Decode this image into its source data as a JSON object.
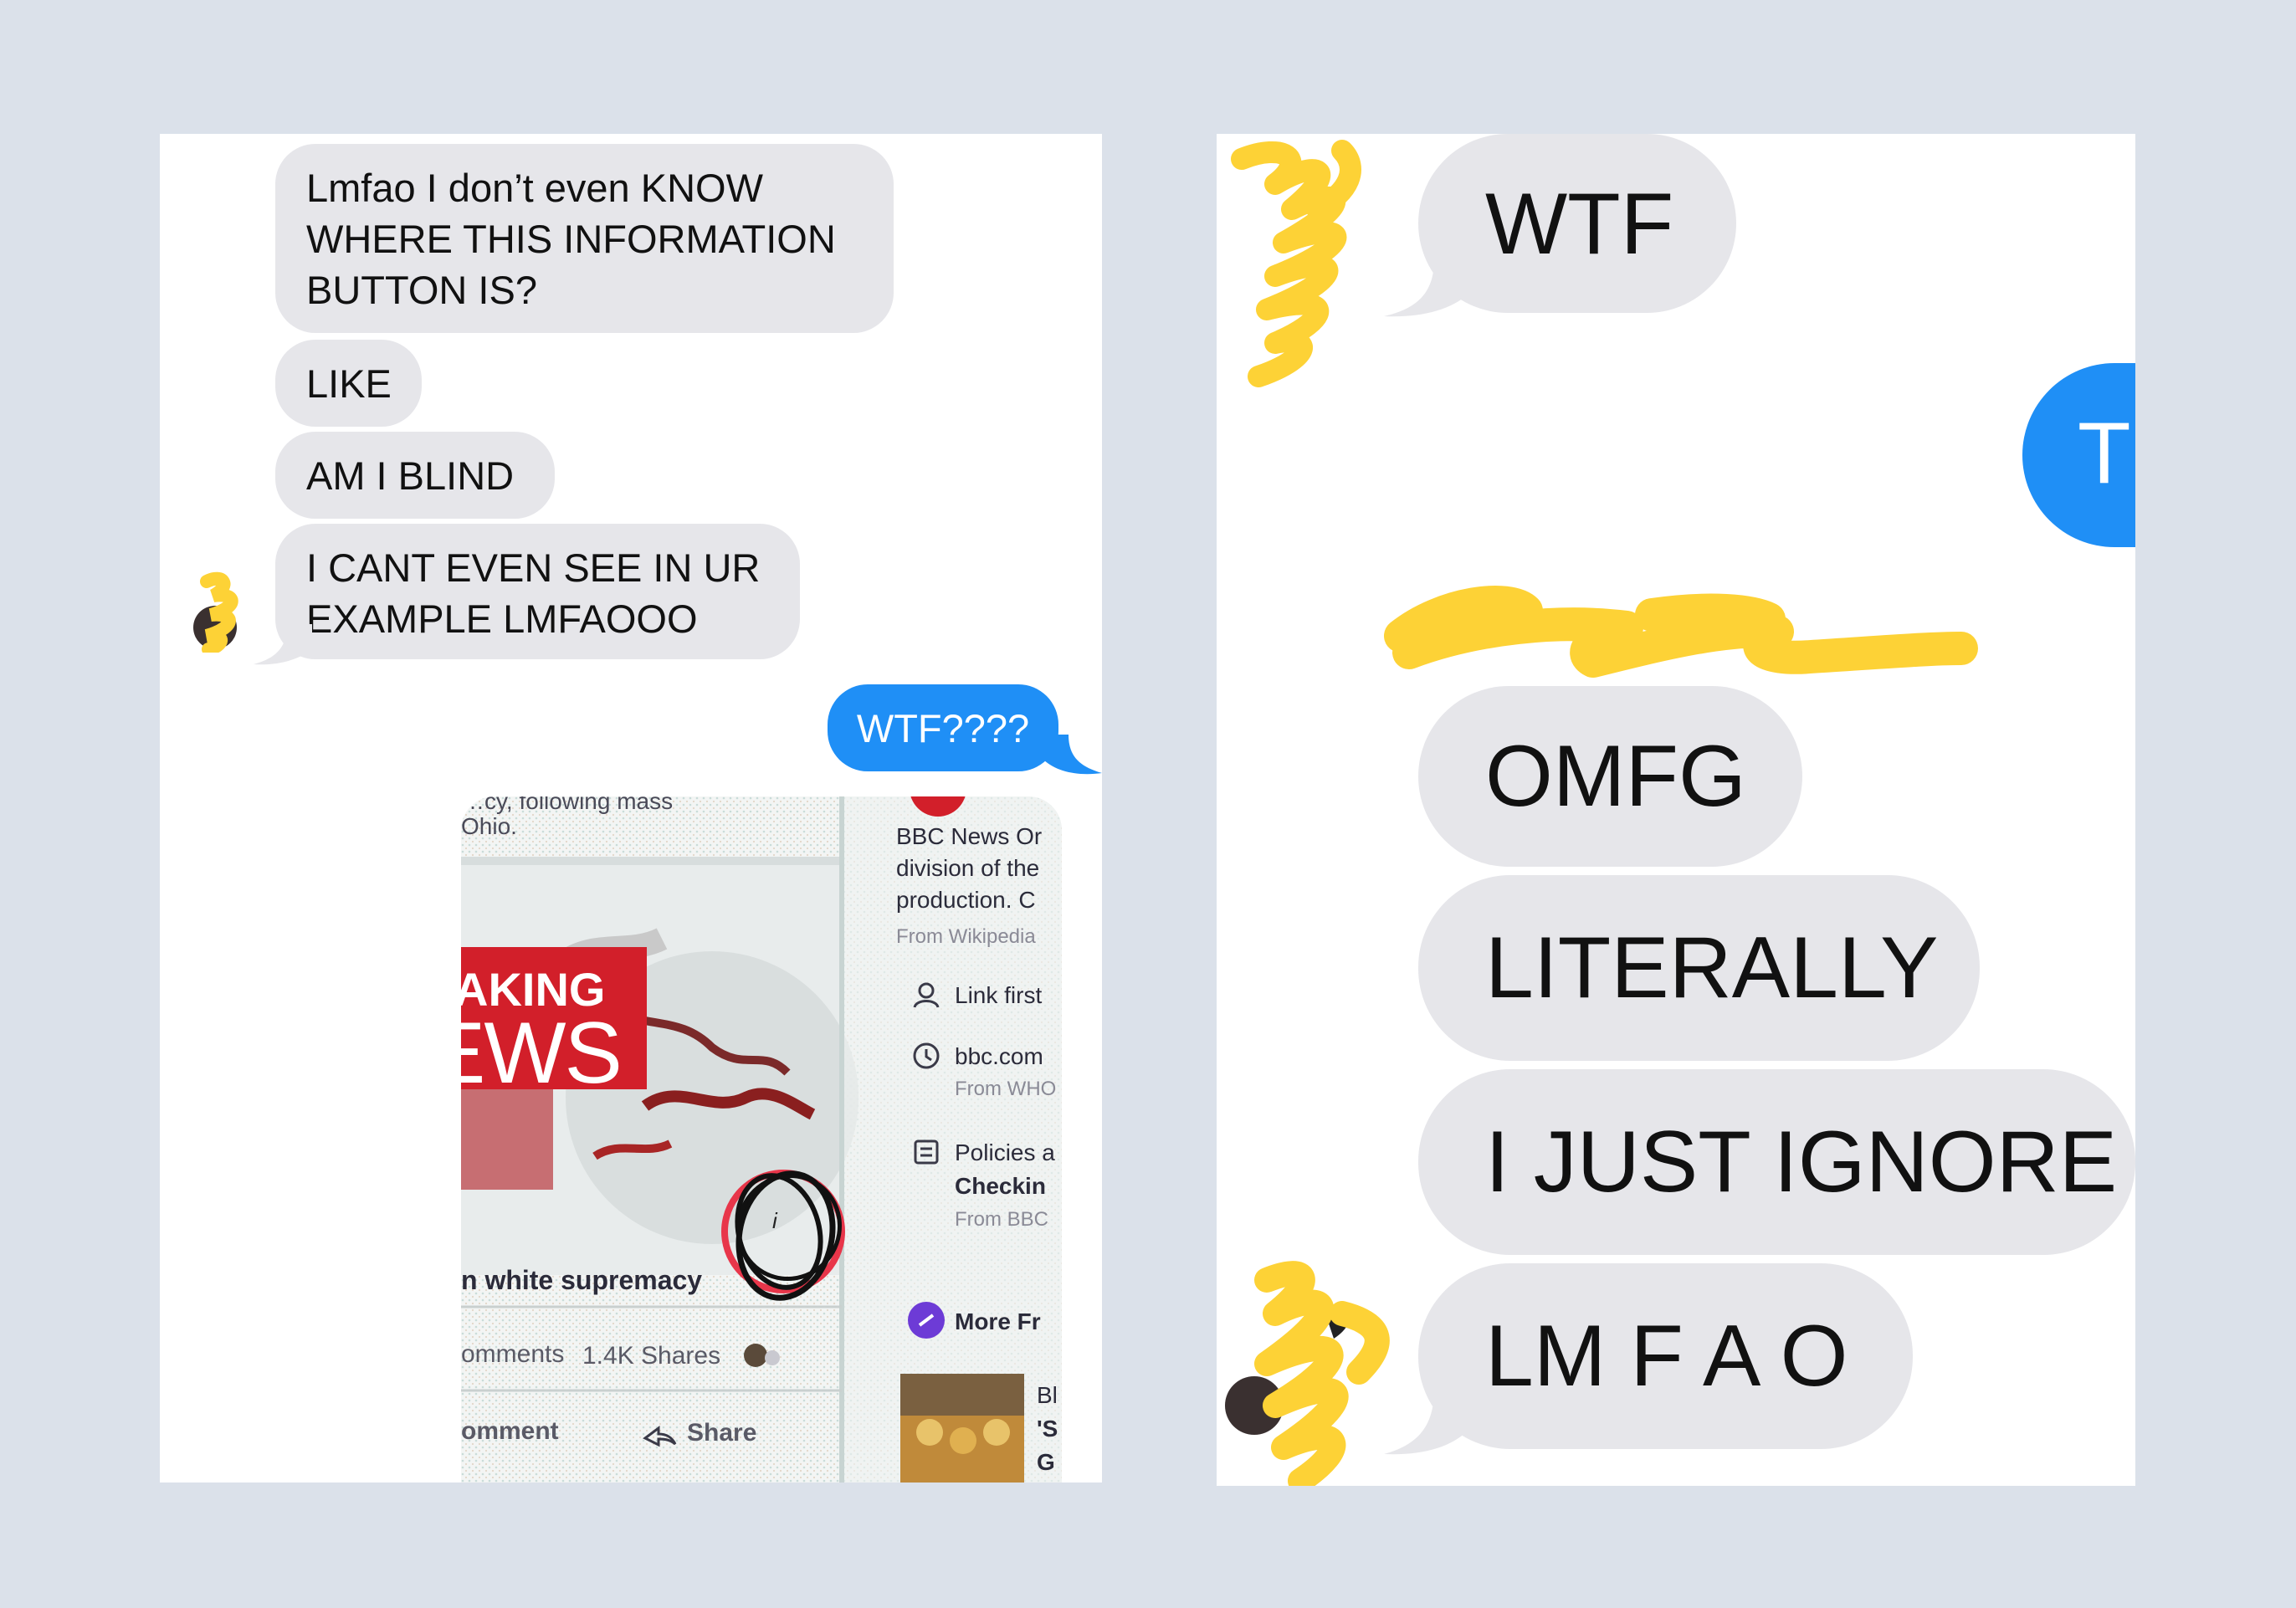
{
  "left_panel": {
    "messages": [
      {
        "text": "Lmfao I don’t even KNOW\nWHERE THIS INFORMATION\nBUTTON IS?"
      },
      {
        "text": "LIKE"
      },
      {
        "text": "AM I BLIND"
      },
      {
        "text": "I CANT EVEN SEE IN UR\nEXAMPLE LMFAOOO"
      },
      {
        "text": "WTF????"
      }
    ],
    "attachment": {
      "top_text": [
        "…cy, following mass",
        "Ohio."
      ],
      "banner_line1": "AKING",
      "banner_line2": "EWS",
      "info_glyph": "i",
      "bbc_about": [
        "BBC News Or",
        "division of the",
        "production. C"
      ],
      "from_wikipedia": "From Wikipedia",
      "link_first": "Link first",
      "bbc_domain": "bbc.com",
      "from_who": "From WHO",
      "policies": "Policies a",
      "checking": "Checkin",
      "from_bbc": "From BBC",
      "headline_fragment": "n white supremacy",
      "comments_fragment": "omments",
      "shares": "1.4K Shares",
      "comment_fragment": "omment",
      "share": "Share",
      "more_from": "More Fr",
      "bottom_right_fragments": [
        "Bl",
        "'S",
        "G"
      ]
    }
  },
  "right_panel": {
    "messages": [
      {
        "text": "WTF"
      },
      {
        "text": "T"
      },
      {
        "text": "OMFG"
      },
      {
        "text": "LITERALLY"
      },
      {
        "text": "I JUST IGNORE"
      },
      {
        "text": "LM F A O"
      }
    ]
  },
  "colors": {
    "background": "#dbe1ea",
    "incoming_bubble": "#e6e6ea",
    "outgoing_bubble": "#1f8ff6",
    "redaction_scribble": "#fdd236",
    "bbc_red": "#d21f2a",
    "circle_mark": "#111111"
  },
  "icons": [
    "avatar-redacted",
    "share-arrow-icon",
    "link-person-icon",
    "clock-icon",
    "document-icon",
    "more-from-page-icon",
    "info-icon"
  ]
}
